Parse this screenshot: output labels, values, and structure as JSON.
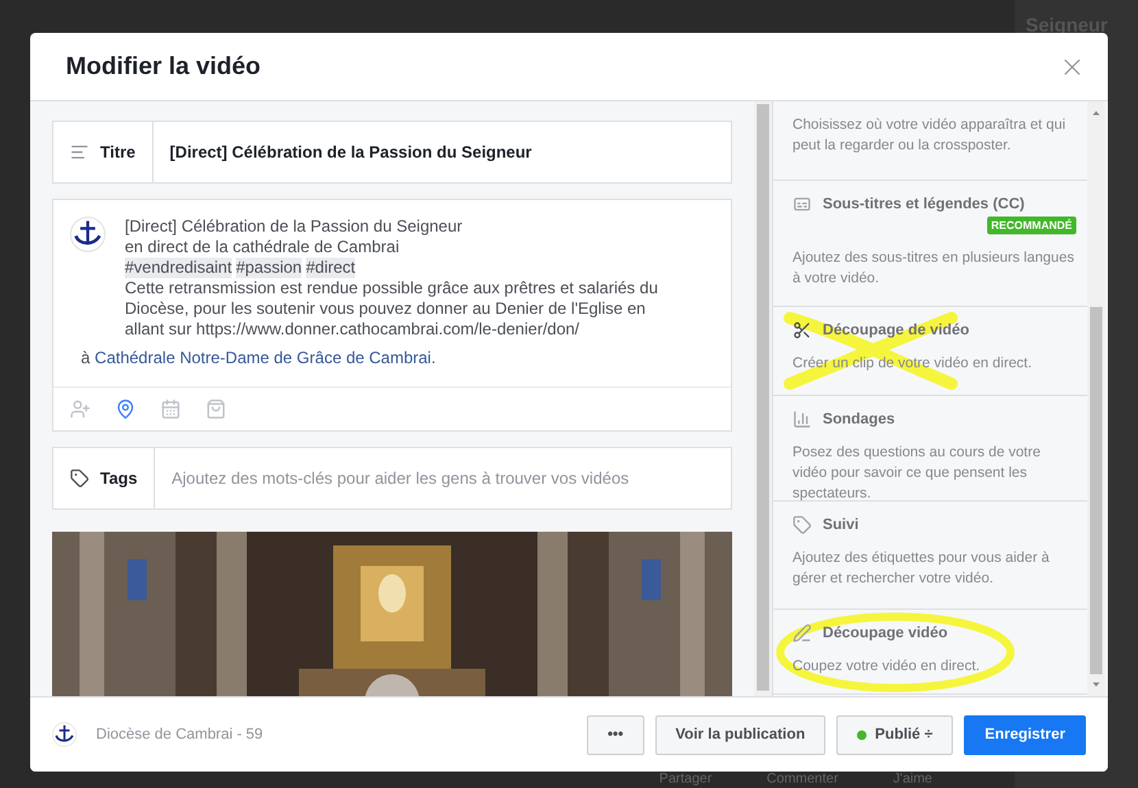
{
  "background": {
    "sidebar_title": "Seigneur",
    "actions": [
      "Partager",
      "Commenter",
      "J'aime"
    ]
  },
  "dialog": {
    "title": "Modifier la vidéo"
  },
  "title_field": {
    "label": "Titre",
    "value": "[Direct] Célébration de la Passion du Seigneur"
  },
  "description": [
    {
      "kind": "text",
      "text": "[Direct] Célébration de la Passion du Seigneur"
    },
    {
      "kind": "text",
      "text": "en direct de la cathédrale de Cambrai"
    },
    {
      "kind": "hashtags",
      "tags": [
        "#vendredisaint",
        "#passion",
        "#direct"
      ]
    },
    {
      "kind": "text",
      "text": "Cette retransmission est rendue possible grâce aux prêtres et salariés du Diocèse, pour les soutenir vous pouvez donner au Denier de l'Eglise en allant sur https://www.donner.cathocambrai.com/le-denier/don/"
    }
  ],
  "location": {
    "prefix": "à",
    "place": "Cathédrale Notre-Dame de Grâce de Cambrai."
  },
  "post_tools": [
    {
      "kind": "person",
      "selected": false
    },
    {
      "kind": "place",
      "selected": true
    },
    {
      "kind": "event",
      "selected": false
    },
    {
      "kind": "product",
      "selected": false
    }
  ],
  "tags_field": {
    "label": "Tags",
    "placeholder": "Ajoutez des mots-clés pour aider les gens à trouver vos vidéos"
  },
  "sections": [
    {
      "description": "Choisissez où votre vidéo apparaîtra et qui peut la regarder ou la crossposter."
    },
    {
      "title": "Sous-titres et légendes (CC)",
      "badge": "RECOMMANDÉ",
      "description": "Ajoutez des sous-titres en plusieurs langues à votre vidéo."
    },
    {
      "title": "Découpage de vidéo",
      "description": "Créer un clip de votre vidéo en direct.",
      "marks": [
        {
          "kind": "cross"
        }
      ]
    },
    {
      "title": "Sondages",
      "description": "Posez des questions au cours de votre vidéo pour savoir ce que pensent les spectateurs."
    },
    {
      "title": "Suivi",
      "description": "Ajoutez des étiquettes pour vous aider à gérer et rechercher votre vidéo."
    },
    {
      "title": "Découpage vidéo",
      "description": "Coupez votre vidéo en direct.",
      "marks": [
        {
          "kind": "circle"
        }
      ]
    }
  ],
  "footer": {
    "page_name": "Diocèse de Cambrai - 59",
    "more_label": "•••",
    "view_label": "Voir la publication",
    "status": {
      "label": "Publié",
      "caret": "÷",
      "published": true
    },
    "save_label": "Enregistrer"
  }
}
